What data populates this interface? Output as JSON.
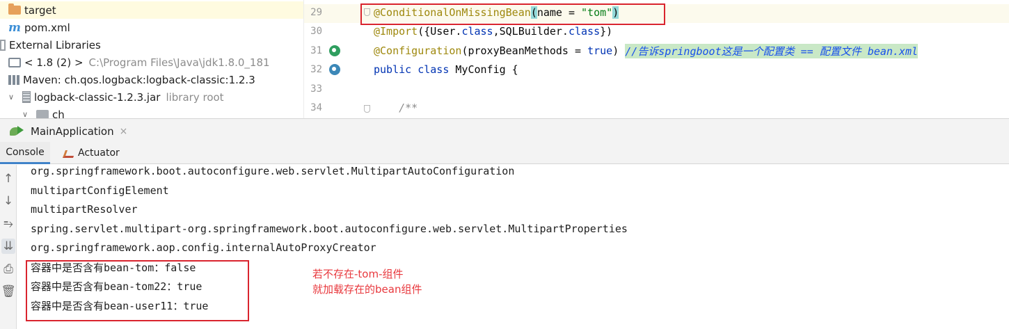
{
  "project_tree": {
    "rows": [
      {
        "label": "target",
        "extra": ""
      },
      {
        "label": "pom.xml",
        "extra": ""
      },
      {
        "label": "External Libraries",
        "extra": ""
      },
      {
        "label": "< 1.8 (2) >",
        "extra": "C:\\Program Files\\Java\\jdk1.8.0_181"
      },
      {
        "label": "Maven: ch.qos.logback:logback-classic:1.2.3",
        "extra": ""
      },
      {
        "label": "logback-classic-1.2.3.jar",
        "extra": "library root"
      },
      {
        "label": "ch",
        "extra": ""
      }
    ]
  },
  "editor": {
    "line_numbers": [
      "29",
      "30",
      "31",
      "32",
      "33",
      "34"
    ],
    "lines": {
      "l29_annotation": "@ConditionalOnMissingBean",
      "l29_open": "(",
      "l29_name": "name = ",
      "l29_str": "\"tom\"",
      "l29_close": ")",
      "l30_annotation": "@Import",
      "l30_body_a": "({User.",
      "l30_kw_a": "class",
      "l30_body_b": ",SQLBuilder.",
      "l30_kw_b": "class",
      "l30_body_c": "})",
      "l31_annotation": "@Configuration",
      "l31_body": "(proxyBeanMethods = ",
      "l31_kw": "true",
      "l31_close": ") ",
      "l31_comment": "//告诉springboot这是一个配置类 == 配置文件 bean.xml",
      "l32_kw": "public class",
      "l32_body": " MyConfig {",
      "l34_comment": "    /**"
    }
  },
  "run_window": {
    "tab_label": "MainApplication",
    "close_glyph": "×",
    "sub_tabs": [
      "Console",
      "Actuator"
    ]
  },
  "console": {
    "lines": [
      "org.springframework.boot.autoconfigure.web.servlet.MultipartAutoConfiguration",
      "multipartConfigElement",
      "multipartResolver",
      "spring.servlet.multipart-org.springframework.boot.autoconfigure.web.servlet.MultipartProperties",
      "org.springframework.aop.config.internalAutoProxyCreator",
      "容器中是否含有bean-tom：false",
      "容器中是否含有bean-tom22：true",
      "容器中是否含有bean-user11：true"
    ]
  },
  "annotation_note": {
    "line1": "若不存在-tom-组件",
    "line2": "就加载存在的bean组件"
  }
}
